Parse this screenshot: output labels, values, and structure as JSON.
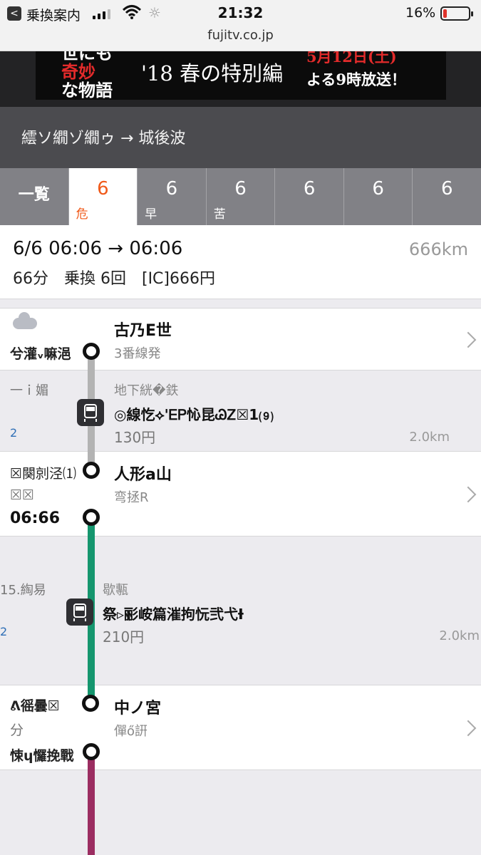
{
  "status": {
    "app": "乗換案内",
    "time": "21:32",
    "battery_pct": "16%",
    "battery_level": 0.16,
    "back_icon": "<",
    "wifi_icon": "wifi-icon",
    "spinner_icon": "☼"
  },
  "url": "fujitv.co.jp",
  "banner": {
    "left_line1": "世にも",
    "left_line2": "奇妙",
    "left_line3": "な物語",
    "mid": "'18 春の特別編",
    "right_line1": "5月12日(土)",
    "right_line2": "よる9時放送！"
  },
  "route": {
    "title": "繧ソ繝ゾ繝ゥ → 城後波"
  },
  "tabs": [
    {
      "num": "一覧",
      "sub": ""
    },
    {
      "num": "6",
      "sub": "危"
    },
    {
      "num": "6",
      "sub": "早"
    },
    {
      "num": "6",
      "sub": "苦"
    },
    {
      "num": "6",
      "sub": ""
    },
    {
      "num": "6",
      "sub": ""
    },
    {
      "num": "6",
      "sub": ""
    }
  ],
  "summary": {
    "time": "6/6 06:06 → 06:06",
    "distance": "666km",
    "detail": "66分　乗換 6回　[IC]666円"
  },
  "stations": [
    {
      "name": "古乃E世",
      "sub": "3番線発",
      "left_top": "",
      "left_bottom": "兮灌ᵥ嘛浥"
    },
    {
      "name": "人形a山",
      "sub": "弯拯R",
      "left_top": "☒闋剠泾⑴",
      "left_mid": "☒☒",
      "left_bottom": "06:66"
    },
    {
      "name": "中ノ宮",
      "sub": "僤ő詽",
      "left_top": "ᕕ徭曇☒",
      "left_mid": "分",
      "left_bottom": "悚ɥ㦬挽戰"
    }
  ],
  "segments": [
    {
      "left_top": "⼀ｉ媚",
      "left_count": "2",
      "line": "地下絖�鉄",
      "name": "◎線忔⟡'ᎬᏢ㤈昆ᏊᏃ☒1⑼",
      "fare": "130円",
      "distance": "2.0km"
    },
    {
      "left_top": "15.綯易",
      "left_count": "2",
      "line": "歇甎",
      "name": "祭▹彨峖篇漼拘忨弐弋Ɨ",
      "fare": "210円",
      "distance": "2.0km"
    }
  ],
  "colors": {
    "active_tab": "#f05a1a",
    "subway_line": "#b3b3b3",
    "jr_line": "#15966e",
    "next_line": "#9b2d61"
  }
}
